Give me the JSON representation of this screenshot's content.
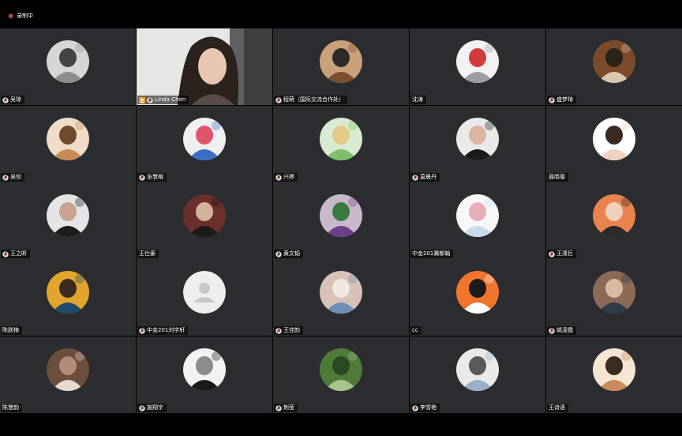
{
  "recording": {
    "label": "录制中"
  },
  "host": {
    "name": "Linda Chen"
  },
  "participants": [
    {
      "name": "吴琼",
      "mic": true,
      "avatar": "cat-icon",
      "colors": [
        "#d6d6d6",
        "#8e8e8e",
        "#444"
      ]
    },
    {
      "name": "Linda Chen",
      "mic": true,
      "video": true
    },
    {
      "name": "程萌（国际交流合作处）",
      "mic": true,
      "avatar": "cat-icon",
      "colors": [
        "#c8a07a",
        "#7a4e2f",
        "#2d2a29"
      ]
    },
    {
      "name": "沈涛",
      "mic": false,
      "avatar": "cat-icon",
      "colors": [
        "#f2f2f2",
        "#9a9da3",
        "#d23b3b"
      ]
    },
    {
      "name": "盛梦琦",
      "mic": true,
      "avatar": "photo-icon",
      "colors": [
        "#7b4a2b",
        "#d9c7b2",
        "#2b2219"
      ]
    },
    {
      "name": "吴佼",
      "mic": true,
      "avatar": "child-icon",
      "colors": [
        "#eedcc6",
        "#c78b5a",
        "#6f4b2e"
      ]
    },
    {
      "name": "张慧榕",
      "mic": true,
      "avatar": "anime-icon",
      "colors": [
        "#f0f0f0",
        "#3b6fc3",
        "#e0556d"
      ]
    },
    {
      "name": "兴婷",
      "mic": true,
      "avatar": "cartoon-icon",
      "colors": [
        "#d8ead0",
        "#7fbf6a",
        "#e3c98a"
      ]
    },
    {
      "name": "莫晨丹",
      "mic": true,
      "avatar": "person-icon",
      "colors": [
        "#e9e9e9",
        "#1b1b1b",
        "#d9b5a2"
      ]
    },
    {
      "name": "聂晓菊",
      "mic": false,
      "avatar": "child-icon",
      "colors": [
        "#ffffff",
        "#f1d2c0",
        "#3b2a22"
      ]
    },
    {
      "name": "王之昕",
      "mic": true,
      "avatar": "person-icon",
      "colors": [
        "#e4e4e4",
        "#1c1c1c",
        "#c7a390"
      ]
    },
    {
      "name": "王仕豪",
      "mic": false,
      "avatar": "person-icon",
      "colors": [
        "#6b2f2c",
        "#1f1a1a",
        "#d2b29a"
      ]
    },
    {
      "name": "黄文韬",
      "mic": true,
      "avatar": "purple-character-icon",
      "colors": [
        "#c9b8c9",
        "#6f3e8b",
        "#3a7a3f"
      ]
    },
    {
      "name": "中金201冀郁翰",
      "mic": false,
      "avatar": "cartoon-icon",
      "colors": [
        "#f7f7f7",
        "#c9d9ee",
        "#e7b0b9"
      ]
    },
    {
      "name": "王潇巨",
      "mic": true,
      "avatar": "person-icon",
      "colors": [
        "#e9844f",
        "#2a2a2a",
        "#f0d0bb"
      ]
    },
    {
      "name": "陈朕梅",
      "mic": false,
      "avatar": "painting-icon",
      "colors": [
        "#e0a52c",
        "#1e4b6e",
        "#3b2a1e"
      ]
    },
    {
      "name": "中金201刘宇轩",
      "mic": true,
      "avatar": "default-user-icon",
      "colors": [
        "#eeeeee",
        "#c8c8c8",
        "#ffffff"
      ]
    },
    {
      "name": "王佳韵",
      "mic": true,
      "avatar": "photo-icon",
      "colors": [
        "#d6c2b6",
        "#6d8fb8",
        "#efe8e0"
      ]
    },
    {
      "name": "cc",
      "mic": false,
      "avatar": "cartoon-icon",
      "colors": [
        "#f0742c",
        "#ffffff",
        "#1b1b1b"
      ]
    },
    {
      "name": "姚凌霞",
      "mic": true,
      "avatar": "person-icon",
      "colors": [
        "#8b6a57",
        "#2e3b4a",
        "#d9b9a0"
      ]
    },
    {
      "name": "陈慧韵",
      "mic": false,
      "avatar": "photo-icon",
      "colors": [
        "#6b4e3c",
        "#e8d8d0",
        "#b48a7a"
      ]
    },
    {
      "name": "施翔宇",
      "mic": true,
      "avatar": "anime-icon",
      "colors": [
        "#f2f2f2",
        "#1a1a1a",
        "#8c8c8c"
      ]
    },
    {
      "name": "荆莹",
      "mic": true,
      "avatar": "photo-icon",
      "colors": [
        "#4f7a3a",
        "#a7c48c",
        "#2a4a23"
      ]
    },
    {
      "name": "李雪艳",
      "mic": true,
      "avatar": "photo-icon",
      "colors": [
        "#e9e9e9",
        "#9ab0c8",
        "#5a5a5a"
      ]
    },
    {
      "name": "王诗语",
      "mic": false,
      "avatar": "child-icon",
      "colors": [
        "#f4e6d2",
        "#c98b5a",
        "#3b2b20"
      ]
    }
  ]
}
